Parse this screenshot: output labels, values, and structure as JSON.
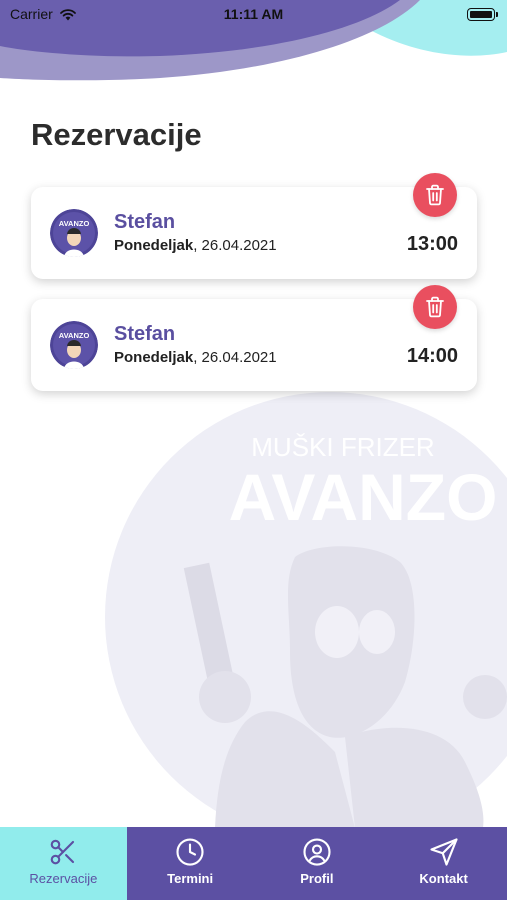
{
  "status_bar": {
    "carrier": "Carrier",
    "time": "11:11 AM"
  },
  "page_title": "Rezervacije",
  "reservations": [
    {
      "name": "Stefan",
      "day": "Ponedeljak",
      "date": ", 26.04.2021",
      "time": "13:00"
    },
    {
      "name": "Stefan",
      "day": "Ponedeljak",
      "date": ", 26.04.2021",
      "time": "14:00"
    }
  ],
  "watermark": {
    "subtitle": "MUŠKI FRIZER",
    "brand": "AVANZO"
  },
  "avatar_text": "AVANZO",
  "tabs": [
    {
      "label": "Rezervacije",
      "icon": "scissors-icon",
      "active": true
    },
    {
      "label": "Termini",
      "icon": "clock-icon",
      "active": false
    },
    {
      "label": "Profil",
      "icon": "user-icon",
      "active": false
    },
    {
      "label": "Kontakt",
      "icon": "send-icon",
      "active": false
    }
  ],
  "colors": {
    "primary": "#5c50a3",
    "accent": "#91ecec",
    "delete": "#e94f5f",
    "name_text": "#5a4fa0"
  }
}
